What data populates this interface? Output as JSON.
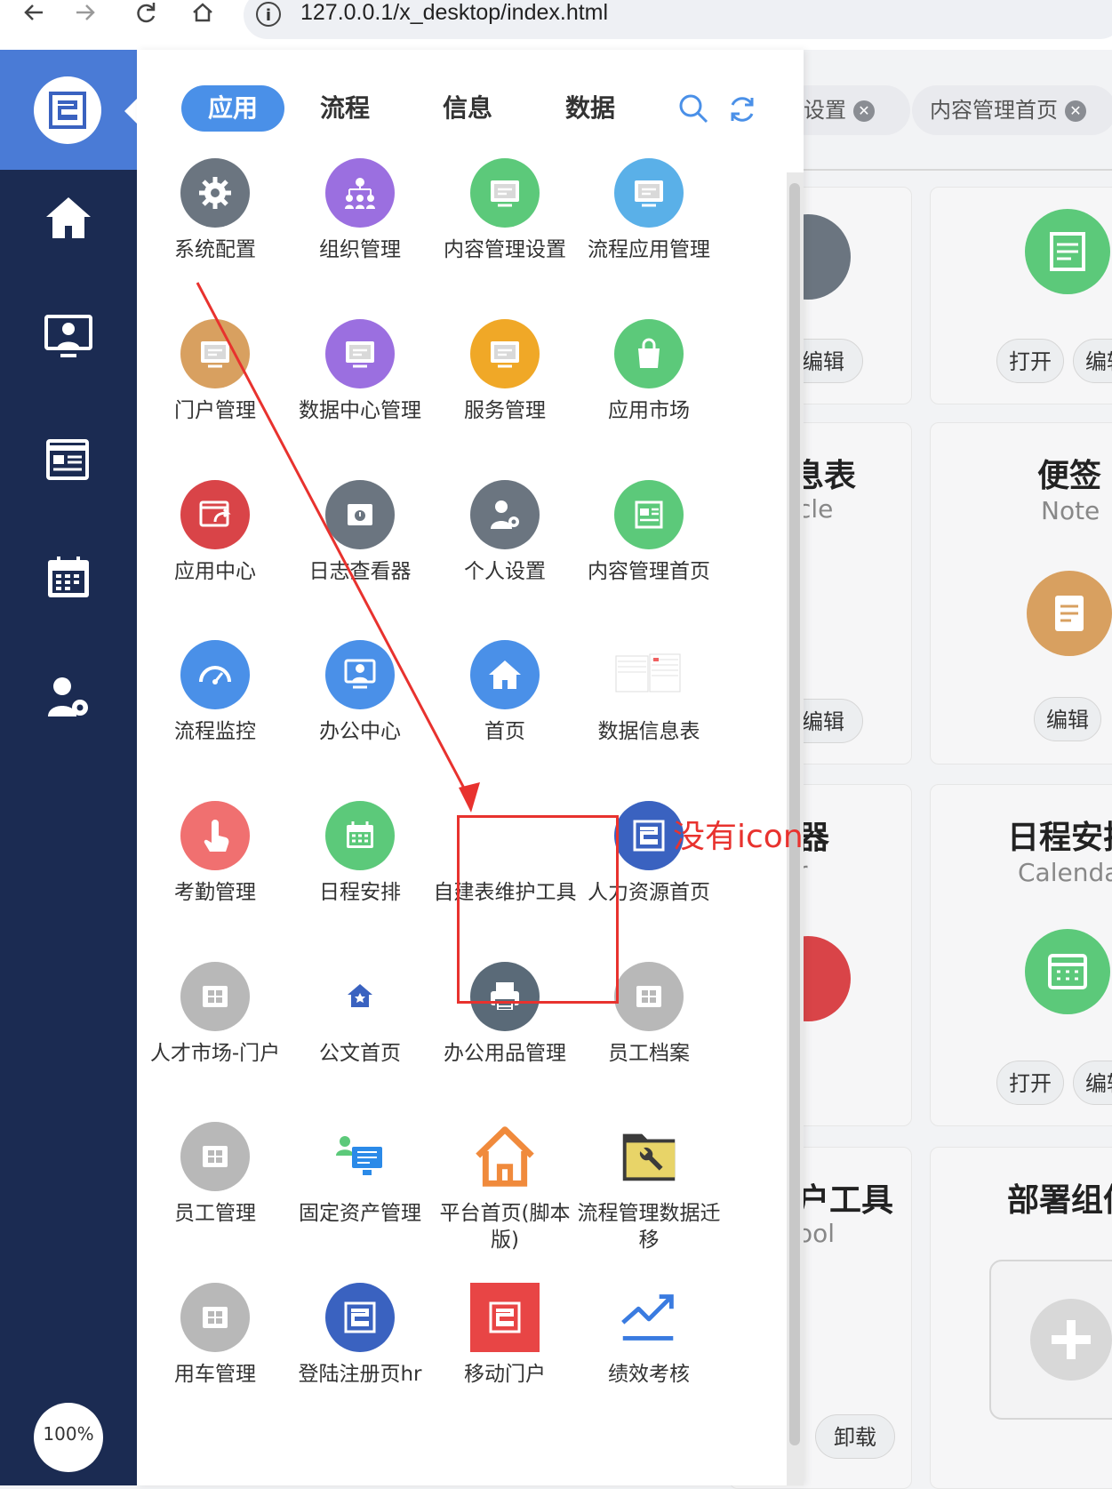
{
  "browser": {
    "url": "127.0.0.1/x_desktop/index.html",
    "back_icon": "arrow-left",
    "forward_icon": "arrow-right",
    "reload_icon": "reload",
    "home_icon": "home",
    "info_icon": "info"
  },
  "sidebar": {
    "zoom": "100%"
  },
  "menu": {
    "tabs": [
      {
        "label": "应用",
        "active": true
      },
      {
        "label": "流程",
        "active": false
      },
      {
        "label": "信息",
        "active": false
      },
      {
        "label": "数据",
        "active": false
      }
    ],
    "apps": [
      {
        "label": "系统配置",
        "icon": "gear-icon",
        "color": "#6b7580"
      },
      {
        "label": "组织管理",
        "icon": "org-icon",
        "color": "#9b6fe0"
      },
      {
        "label": "内容管理设置",
        "icon": "content-settings-icon",
        "color": "#5cc97a"
      },
      {
        "label": "流程应用管理",
        "icon": "process-app-icon",
        "color": "#5ab0e8"
      },
      {
        "label": "门户管理",
        "icon": "portal-icon",
        "color": "#d8a060"
      },
      {
        "label": "数据中心管理",
        "icon": "data-center-icon",
        "color": "#9b6fe0"
      },
      {
        "label": "服务管理",
        "icon": "service-icon",
        "color": "#f0a827"
      },
      {
        "label": "应用市场",
        "icon": "shopping-bag-icon",
        "color": "#5cc97a"
      },
      {
        "label": "应用中心",
        "icon": "app-center-icon",
        "color": "#d94448"
      },
      {
        "label": "日志查看器",
        "icon": "log-viewer-icon",
        "color": "#6b7580"
      },
      {
        "label": "个人设置",
        "icon": "personal-settings-icon",
        "color": "#6b7580"
      },
      {
        "label": "内容管理首页",
        "icon": "content-home-icon",
        "color": "#5cc97a"
      },
      {
        "label": "流程监控",
        "icon": "gauge-icon",
        "color": "#4a90e8"
      },
      {
        "label": "办公中心",
        "icon": "office-icon",
        "color": "#4a90e8"
      },
      {
        "label": "首页",
        "icon": "home-icon",
        "color": "#4a90e8"
      },
      {
        "label": "数据信息表",
        "icon": "data-sheet-icon",
        "color": ""
      },
      {
        "label": "考勤管理",
        "icon": "attendance-icon",
        "color": "#f07070"
      },
      {
        "label": "日程安排",
        "icon": "calendar-icon",
        "color": "#5cc97a"
      },
      {
        "label": "自建表维护工具",
        "icon": "",
        "color": ""
      },
      {
        "label": "人力资源首页",
        "icon": "hr-logo-icon",
        "color": "#3a62c0"
      },
      {
        "label": "人才市场-门户",
        "icon": "grid-app-icon",
        "color": "#b8b8b8"
      },
      {
        "label": "公文首页",
        "icon": "document-home-icon",
        "color": ""
      },
      {
        "label": "办公用品管理",
        "icon": "printer-icon",
        "color": "#5a6a78"
      },
      {
        "label": "员工档案",
        "icon": "grid-app-icon",
        "color": "#b8b8b8"
      },
      {
        "label": "员工管理",
        "icon": "grid-app-icon",
        "color": "#b8b8b8"
      },
      {
        "label": "固定资产管理",
        "icon": "asset-icon",
        "color": ""
      },
      {
        "label": "平台首页(脚本版)",
        "icon": "house-outline-icon",
        "color": "#f08a3c"
      },
      {
        "label": "流程管理数据迁移",
        "icon": "folder-tool-icon",
        "color": ""
      },
      {
        "label": "用车管理",
        "icon": "grid-app-icon",
        "color": "#b8b8b8"
      },
      {
        "label": "登陆注册页hr",
        "icon": "hr-logo-icon",
        "color": "#3a62c0"
      },
      {
        "label": "移动门户",
        "icon": "mobile-portal-icon",
        "color": "#e84545"
      },
      {
        "label": "绩效考核",
        "icon": "trend-icon",
        "color": "#3a7be0"
      }
    ]
  },
  "annotation": {
    "text": "没有icon"
  },
  "background": {
    "tabs": [
      {
        "label": "设置"
      },
      {
        "label": "内容管理首页"
      }
    ],
    "cards": {
      "c1_edit": "编辑",
      "c2_open": "打开",
      "c2_edit": "编辑",
      "c3_title": "息表",
      "c3_sub": "cle",
      "c3_edit": "编辑",
      "c4_title": "便签",
      "c4_sub": "Note",
      "c4_edit": "编辑",
      "c5_title": "器",
      "c5_sub": "r",
      "c6_title": "日程安排",
      "c6_sub": "Calendar",
      "c6_open": "打开",
      "c6_edit": "编辑",
      "c7_title": "户工具",
      "c7_sub": "ool",
      "c7_uninstall": "卸载",
      "c8_title": "部署组件"
    }
  },
  "colors": {
    "sidebar_dark": "#1b2b52",
    "sidebar_logo_bg": "#4a7bd6",
    "accent": "#4a90e8",
    "annotation_red": "#e8322e"
  }
}
